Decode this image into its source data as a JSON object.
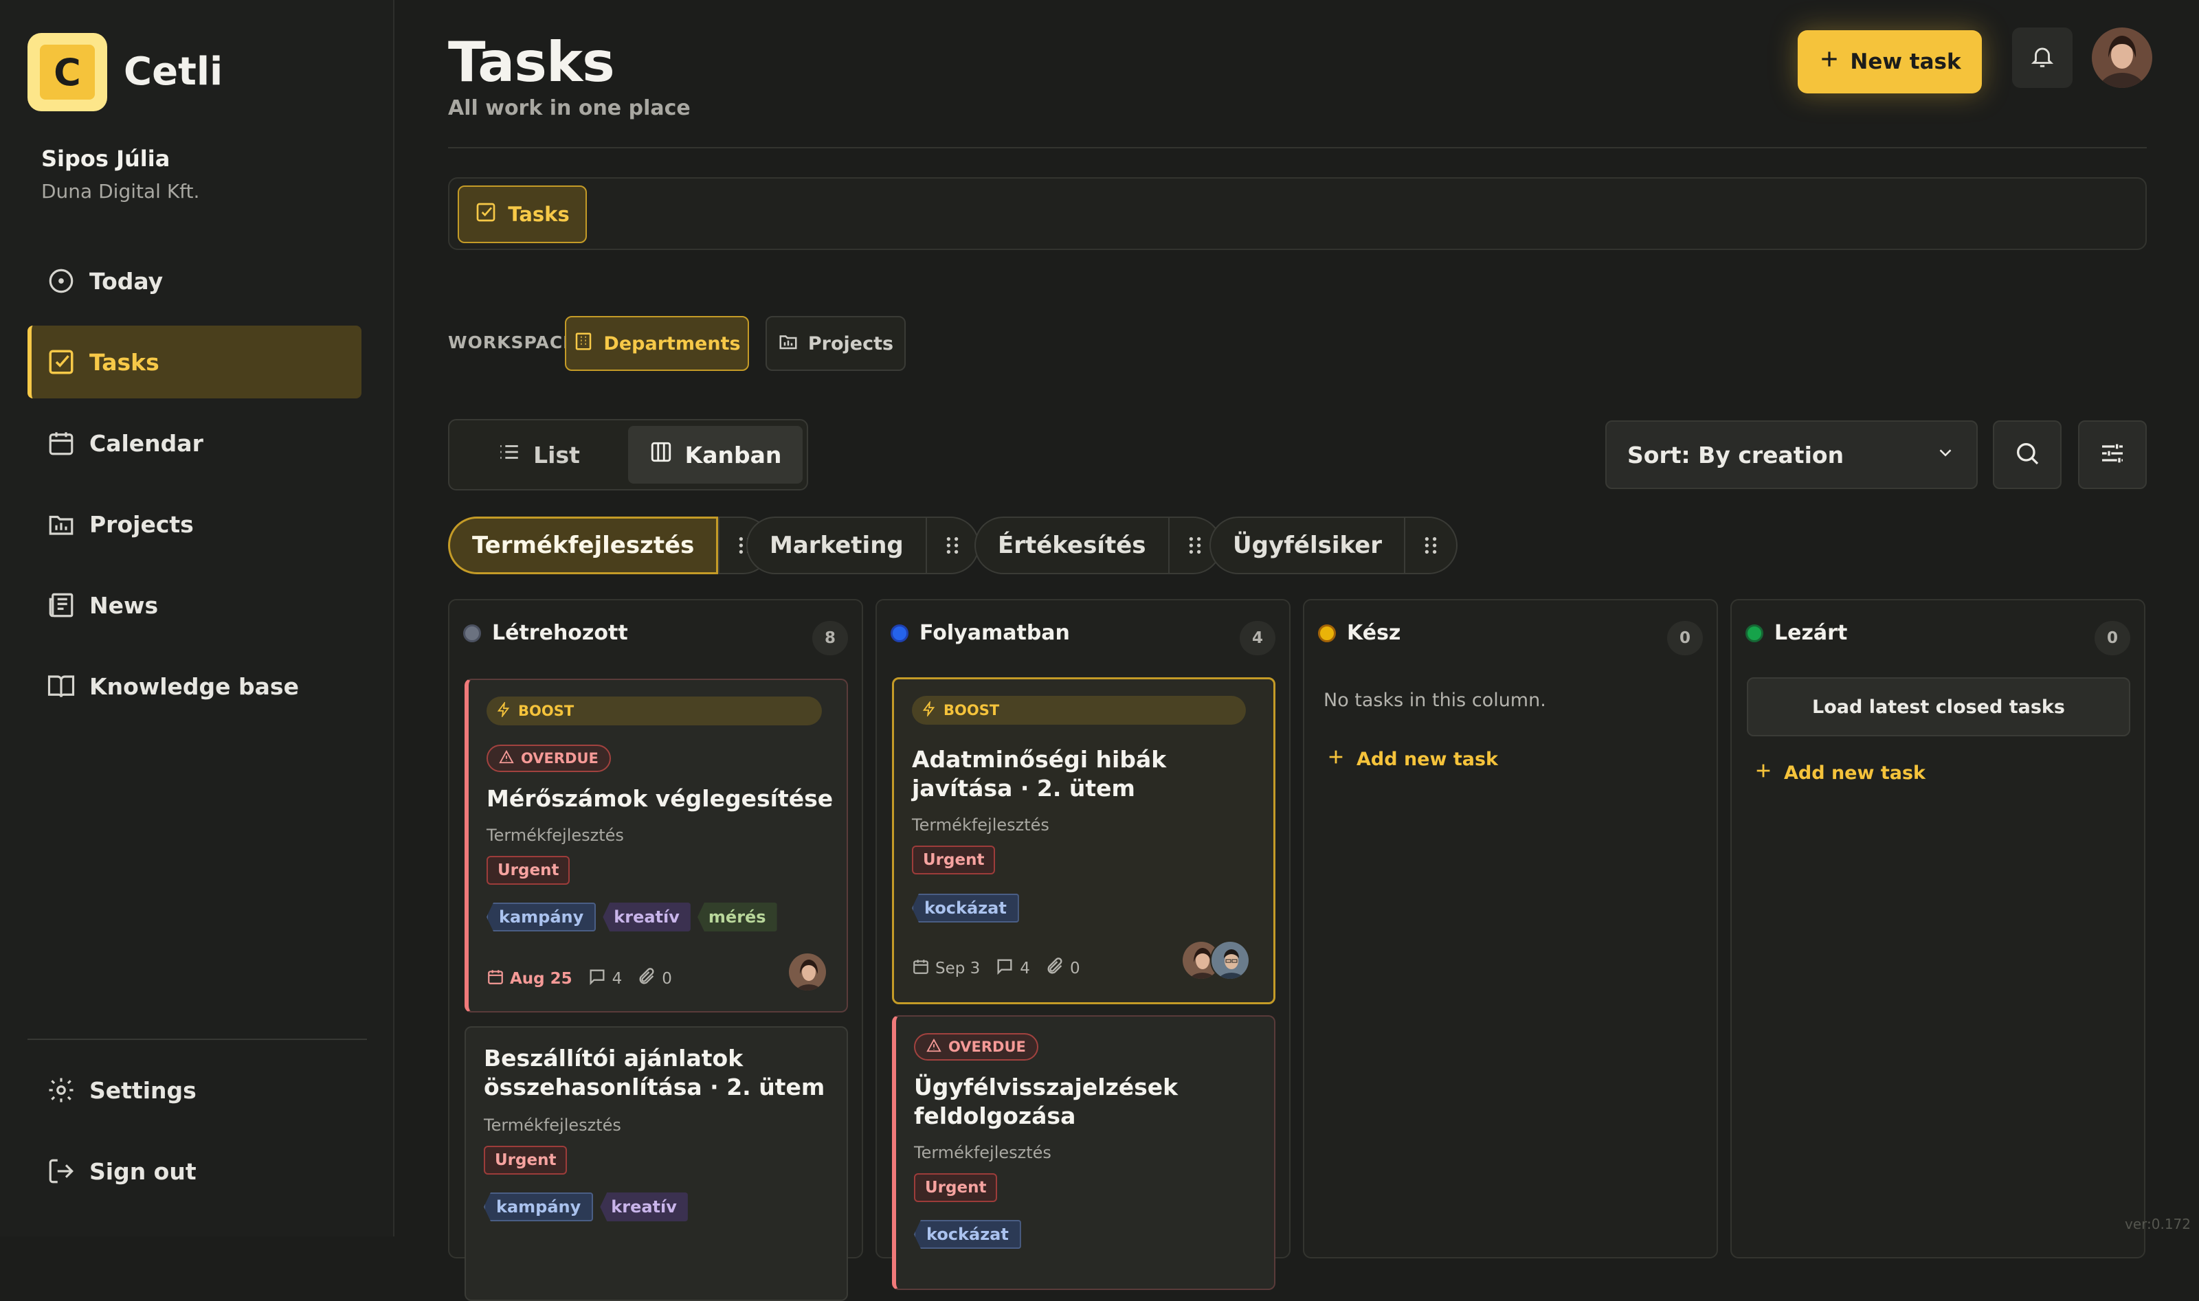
{
  "app": {
    "brand": "Cetli",
    "logo_letter": "C",
    "version": "ver:0.172"
  },
  "user": {
    "name": "Sipos Júlia",
    "org": "Duna Digital Kft."
  },
  "nav": {
    "items": [
      {
        "label": "Today",
        "icon": "clock-icon"
      },
      {
        "label": "Tasks",
        "icon": "checkbox-icon",
        "active": true
      },
      {
        "label": "Calendar",
        "icon": "calendar-icon"
      },
      {
        "label": "Projects",
        "icon": "folder-chart-icon"
      },
      {
        "label": "News",
        "icon": "newspaper-icon"
      },
      {
        "label": "Knowledge base",
        "icon": "book-icon"
      }
    ],
    "bottom": [
      {
        "label": "Settings",
        "icon": "gear-icon"
      },
      {
        "label": "Sign out",
        "icon": "sign-out-icon"
      }
    ]
  },
  "header": {
    "title": "Tasks",
    "subtitle": "All work in one place",
    "new_task_label": "New task"
  },
  "tabs": [
    {
      "label": "Tasks",
      "active": true
    }
  ],
  "workspace": {
    "label": "WORKSPACE",
    "options": [
      {
        "label": "Departments",
        "active": true
      },
      {
        "label": "Projects",
        "active": false
      }
    ]
  },
  "view": {
    "options": [
      {
        "label": "List",
        "active": false
      },
      {
        "label": "Kanban",
        "active": true
      }
    ]
  },
  "sort": {
    "label": "Sort: By creation"
  },
  "departments": [
    {
      "label": "Termékfejlesztés",
      "active": true
    },
    {
      "label": "Marketing",
      "active": false
    },
    {
      "label": "Értékesítés",
      "active": false
    },
    {
      "label": "Ügyfélsiker",
      "active": false
    }
  ],
  "columns": [
    {
      "name": "Létrehozott",
      "count": "8",
      "color": "#6b7280"
    },
    {
      "name": "Folyamatban",
      "count": "4",
      "color": "#2563eb"
    },
    {
      "name": "Kész",
      "count": "0",
      "color": "#eab308",
      "empty_text": "No tasks in this column.",
      "add_label": "Add new task"
    },
    {
      "name": "Lezárt",
      "count": "0",
      "color": "#16a34a",
      "load_label": "Load latest closed tasks",
      "add_label": "Add new task"
    }
  ],
  "cards": {
    "c1": {
      "boost": "BOOST",
      "overdue": "OVERDUE",
      "title": "Mérőszámok véglegesítése",
      "dept": "Termékfejlesztés",
      "priority": "Urgent",
      "tags": [
        "kampány",
        "kreatív",
        "mérés"
      ],
      "due": "Aug 25",
      "comments": "4",
      "attachments": "0"
    },
    "c2": {
      "title": "Beszállítói ajánlatok összehasonlítása · 2. ütem",
      "dept": "Termékfejlesztés",
      "priority": "Urgent",
      "tags": [
        "kampány",
        "kreatív"
      ]
    },
    "c3": {
      "boost": "BOOST",
      "title": "Adatminőségi hibák javítása · 2. ütem",
      "dept": "Termékfejlesztés",
      "priority": "Urgent",
      "tags": [
        "kockázat"
      ],
      "due": "Sep 3",
      "comments": "4",
      "attachments": "0"
    },
    "c4": {
      "overdue": "OVERDUE",
      "title": "Ügyfélvisszajelzések feldolgozása",
      "dept": "Termékfejlesztés",
      "priority": "Urgent",
      "tags": [
        "kockázat"
      ]
    }
  },
  "colors": {
    "accent": "#f5c33b",
    "background": "#1c1d1b",
    "danger": "#f07a7a"
  }
}
